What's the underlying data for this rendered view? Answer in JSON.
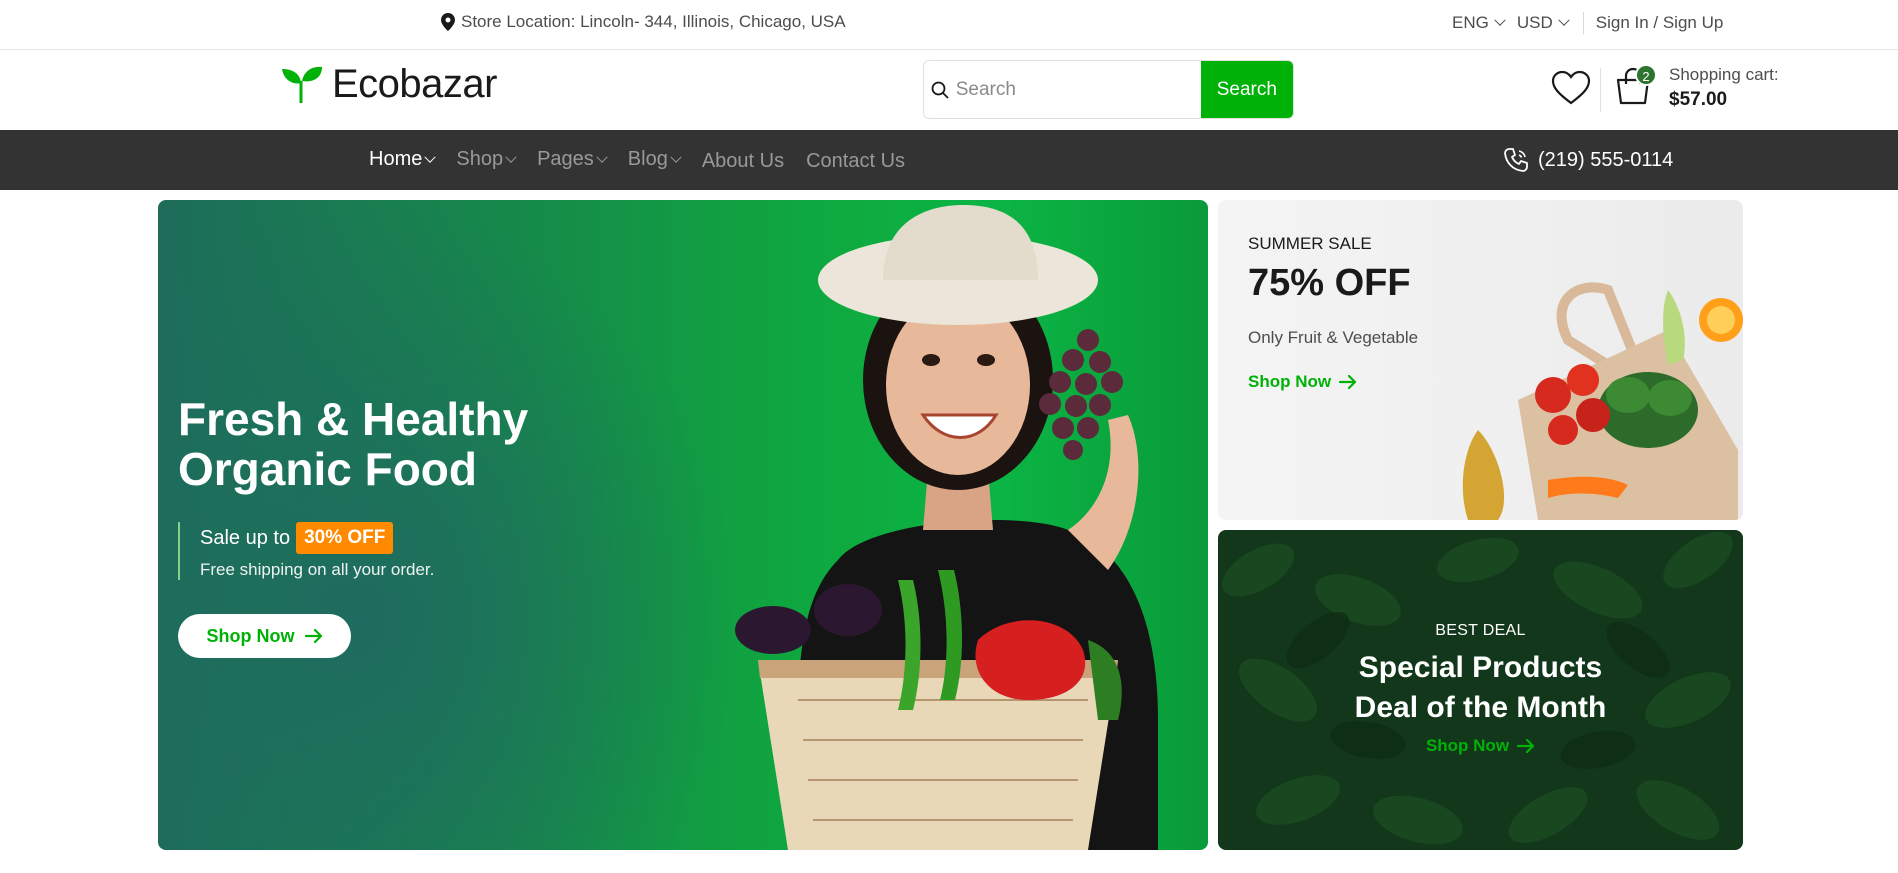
{
  "topbar": {
    "location_icon": "map-pin-icon",
    "location": "Store Location: Lincoln- 344, Illinois, Chicago, USA",
    "language": "ENG",
    "currency": "USD",
    "auth": "Sign In / Sign Up"
  },
  "header": {
    "brand": "Ecobazar",
    "search_placeholder": "Search",
    "search_button": "Search",
    "wishlist_icon": "heart-icon",
    "cart_icon": "shopping-bag-icon",
    "cart_count": "2",
    "cart_label": "Shopping cart:",
    "cart_total": "$57.00"
  },
  "nav": {
    "items": [
      {
        "label": "Home",
        "active": true
      },
      {
        "label": "Shop"
      },
      {
        "label": "Pages"
      },
      {
        "label": "Blog"
      },
      {
        "label": "About Us"
      },
      {
        "label": "Contact Us"
      }
    ],
    "phone_icon": "phone-icon",
    "phone": "(219) 555-0114"
  },
  "hero": {
    "title_line1": "Fresh & Healthy",
    "title_line2": "Organic Food",
    "sale_prefix": "Sale up to",
    "sale_badge": "30% OFF",
    "shipping": "Free shipping on all your order.",
    "cta": "Shop Now"
  },
  "promo_summer": {
    "eyebrow": "SUMMER SALE",
    "headline": "75% OFF",
    "subtitle": "Only Fruit & Vegetable",
    "cta": "Shop Now"
  },
  "promo_deal": {
    "eyebrow": "BEST DEAL",
    "title_line1": "Special Products",
    "title_line2": "Deal of the Month",
    "cta": "Shop Now"
  },
  "colors": {
    "brand_green": "#00b207",
    "dark_green": "#2c742f",
    "nav_bg": "#333333",
    "badge_orange": "#ff8a00"
  }
}
